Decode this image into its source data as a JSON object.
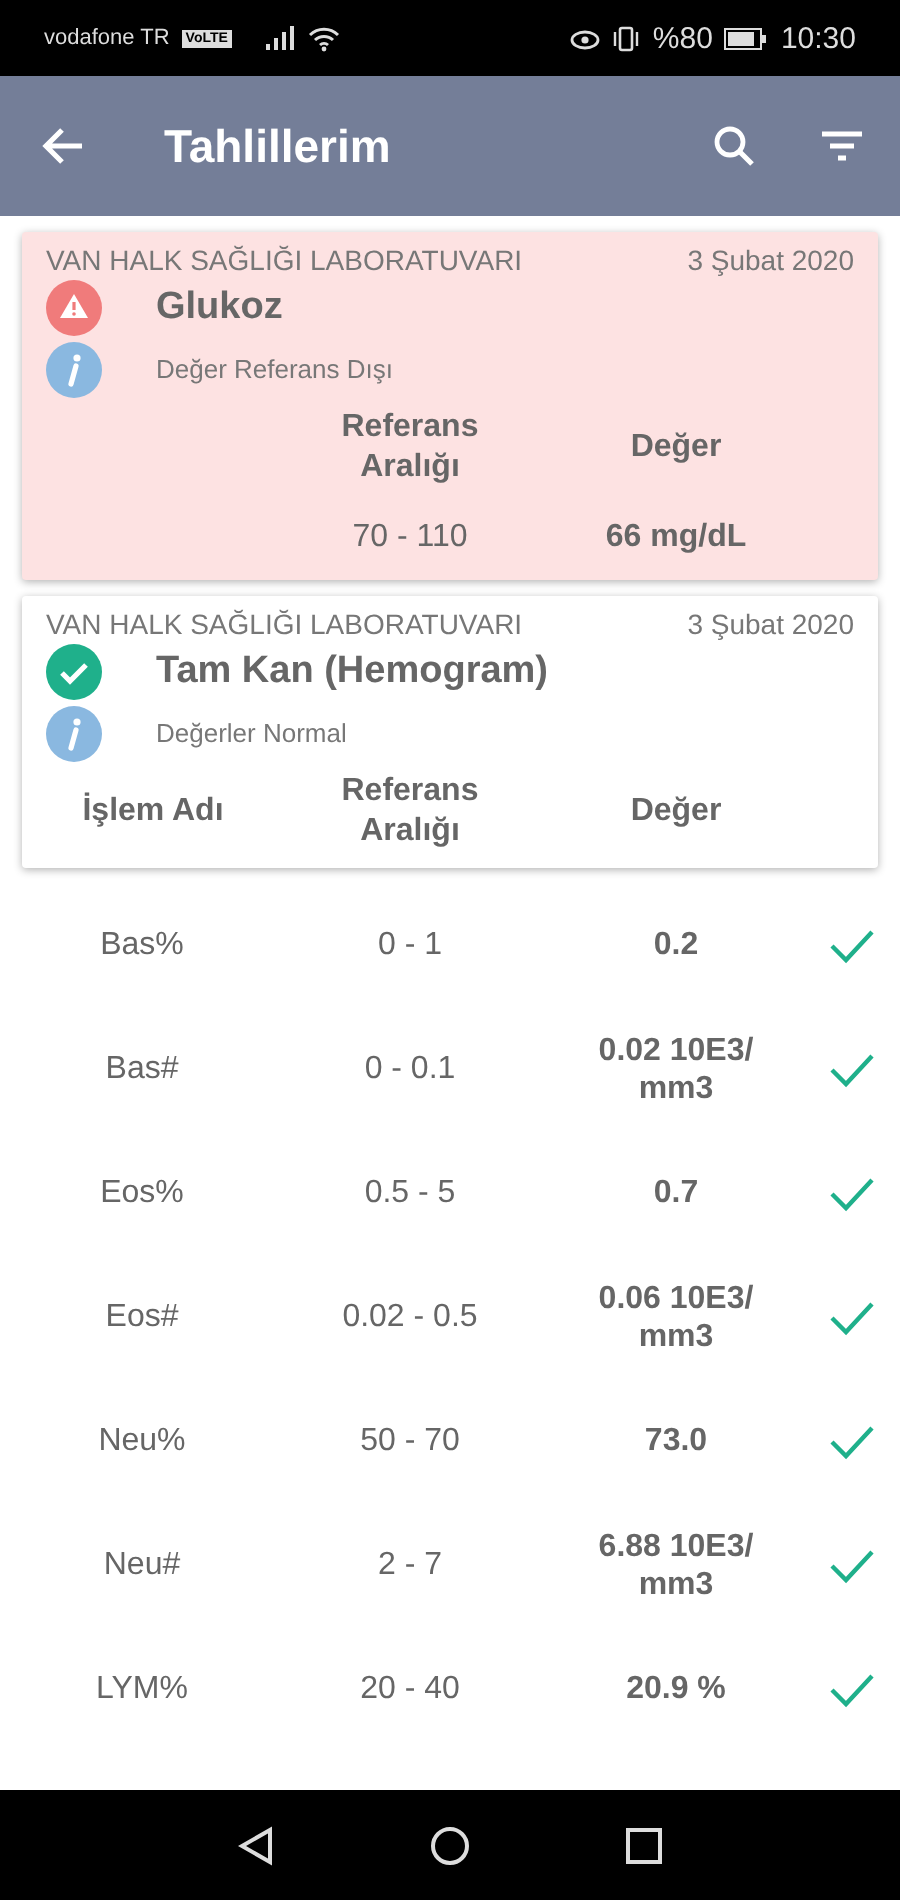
{
  "status_bar": {
    "carrier": "vodafone TR",
    "network_badge": "VoLTE",
    "battery": "%80",
    "time": "10:30"
  },
  "app_bar": {
    "title": "Tahlillerim"
  },
  "cards": [
    {
      "kind": "warning",
      "lab": "VAN HALK SAĞLIĞI LABORATUVARI",
      "date": "3 Şubat 2020",
      "title": "Glukoz",
      "note": "Değer Referans Dışı",
      "columns": [
        "Referans Aralığı",
        "Değer"
      ],
      "rows": [
        {
          "range": "70 - 110",
          "value": "66 mg/dL"
        }
      ]
    },
    {
      "kind": "ok",
      "lab": "VAN HALK SAĞLIĞI LABORATUVARI",
      "date": "3 Şubat 2020",
      "title": "Tam Kan (Hemogram)",
      "note": "Değerler Normal",
      "columns": [
        "İşlem Adı",
        "Referans Aralığı",
        "Değer"
      ]
    }
  ],
  "results": [
    {
      "name": "Bas%",
      "range": "0 - 1",
      "value": "0.2"
    },
    {
      "name": "Bas#",
      "range": "0 - 0.1",
      "value": "0.02 10E3/ mm3"
    },
    {
      "name": "Eos%",
      "range": "0.5 - 5",
      "value": "0.7"
    },
    {
      "name": "Eos#",
      "range": "0.02 - 0.5",
      "value": "0.06 10E3/ mm3"
    },
    {
      "name": "Neu%",
      "range": "50 - 70",
      "value": "73.0"
    },
    {
      "name": "Neu#",
      "range": "2 - 7",
      "value": "6.88 10E3/ mm3"
    },
    {
      "name": "LYM%",
      "range": "20 - 40",
      "value": "20.9 %"
    }
  ]
}
